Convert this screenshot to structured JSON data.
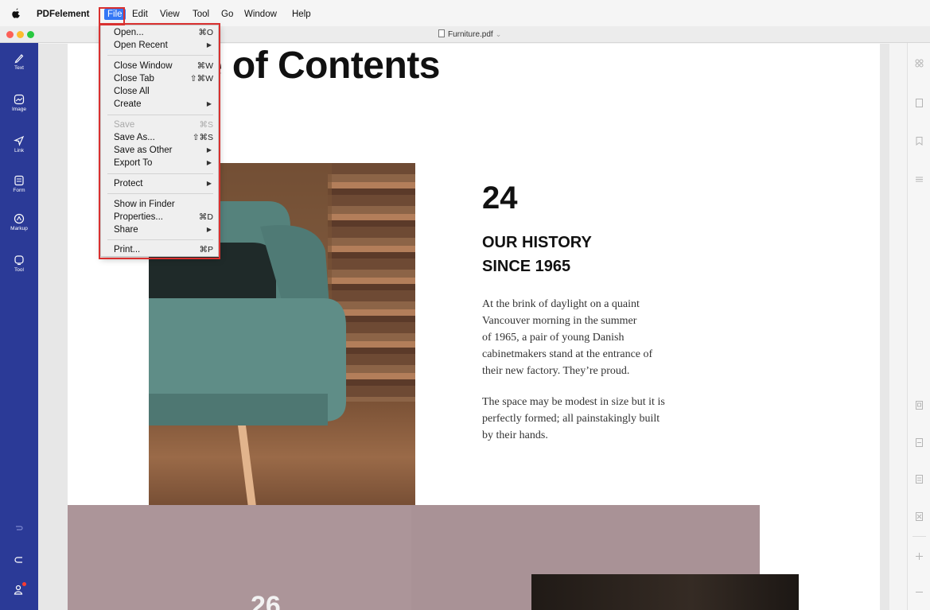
{
  "menubar": {
    "app_name": "PDFelement",
    "items": [
      "File",
      "Edit",
      "View",
      "Tool",
      "Go",
      "Window",
      "Help"
    ]
  },
  "titlebar": {
    "doc_title": "Furniture.pdf"
  },
  "colors": {
    "sidebar": "#2b3a97",
    "highlight_border": "#d9302f",
    "menu_active": "#3477f5",
    "traffic_red": "#fc5f57",
    "traffic_yellow": "#fdbb2e",
    "traffic_green": "#29c840",
    "pink_band": "#a99296"
  },
  "left_tools": [
    {
      "label": "Text",
      "icon": "pen-icon"
    },
    {
      "label": "Image",
      "icon": "image-icon"
    },
    {
      "label": "Link",
      "icon": "link-icon"
    },
    {
      "label": "Form",
      "icon": "form-icon"
    },
    {
      "label": "Markup",
      "icon": "markup-icon"
    },
    {
      "label": "Tool",
      "icon": "tool-icon"
    }
  ],
  "file_menu": {
    "items": [
      {
        "label": "Open...",
        "shortcut": "⌘O"
      },
      {
        "label": "Open Recent",
        "submenu": true
      },
      {
        "label": "Close Window",
        "shortcut": "⌘W"
      },
      {
        "label": "Close Tab",
        "shortcut": "⇧⌘W"
      },
      {
        "label": "Close All"
      },
      {
        "label": "Create",
        "submenu": true
      },
      {
        "label": "Save",
        "shortcut": "⌘S",
        "disabled": true
      },
      {
        "label": "Save As...",
        "shortcut": "⇧⌘S"
      },
      {
        "label": "Save as Other",
        "submenu": true
      },
      {
        "label": "Export To",
        "submenu": true
      },
      {
        "label": "Protect",
        "submenu": true
      },
      {
        "label": "Show in Finder"
      },
      {
        "label": "Properties...",
        "shortcut": "⌘D"
      },
      {
        "label": "Share",
        "submenu": true
      },
      {
        "label": "Print...",
        "shortcut": "⌘P"
      }
    ]
  },
  "document": {
    "heading": "le of Contents",
    "page_number": "24",
    "section_title_line1": "OUR HISTORY",
    "section_title_line2": "SINCE 1965",
    "para1_lines": [
      "At the brink of daylight on a quaint",
      "Vancouver morning in the summer",
      "of 1965, a pair of young Danish",
      "cabinetmakers stand at the entrance of",
      "their new factory. They’re proud."
    ],
    "para2_lines": [
      "The space may be modest in size but it is",
      "perfectly formed; all painstakingly built",
      "by their hands."
    ],
    "bottom_page_number": "26"
  }
}
